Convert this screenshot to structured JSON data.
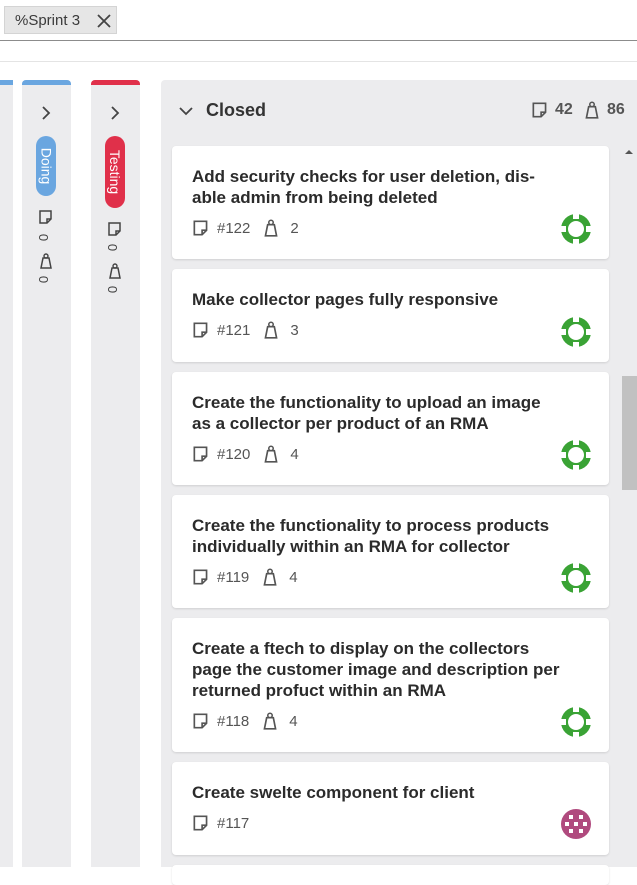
{
  "filter": {
    "label": "%Sprint 3",
    "close_icon": "close-icon"
  },
  "columns": {
    "doing": {
      "label": "Doing",
      "color": "#6aa6e0",
      "tasks": "0",
      "points": "0"
    },
    "testing": {
      "label": "Testing",
      "color": "#e0304a",
      "tasks": "0",
      "points": "0"
    },
    "closed": {
      "label": "Closed",
      "tasks": "42",
      "points": "86"
    }
  },
  "cards": [
    {
      "title_lines": [
        "Add security checks for user deletion, dis-",
        "able admin from being deleted"
      ],
      "id": "#122",
      "points": "2",
      "avatar_color": "#3aa335"
    },
    {
      "title_lines": [
        "Make collector pages fully responsive"
      ],
      "id": "#121",
      "points": "3",
      "avatar_color": "#3aa335"
    },
    {
      "title_lines": [
        "Create the functionality to upload an image",
        "as a collector per product of an RMA"
      ],
      "id": "#120",
      "points": "4",
      "avatar_color": "#3aa335"
    },
    {
      "title_lines": [
        "Create the functionality to process products",
        "individually within an RMA for collector"
      ],
      "id": "#119",
      "points": "4",
      "avatar_color": "#3aa335"
    },
    {
      "title_lines": [
        "Create a ftech to display on the collectors",
        "page the customer image and description per",
        "returned profuct within an RMA"
      ],
      "id": "#118",
      "points": "4",
      "avatar_color": "#3aa335"
    },
    {
      "title_lines": [
        "Create swelte component for client"
      ],
      "id": "#117",
      "points": "",
      "avatar_color": "#b04a7e"
    }
  ]
}
